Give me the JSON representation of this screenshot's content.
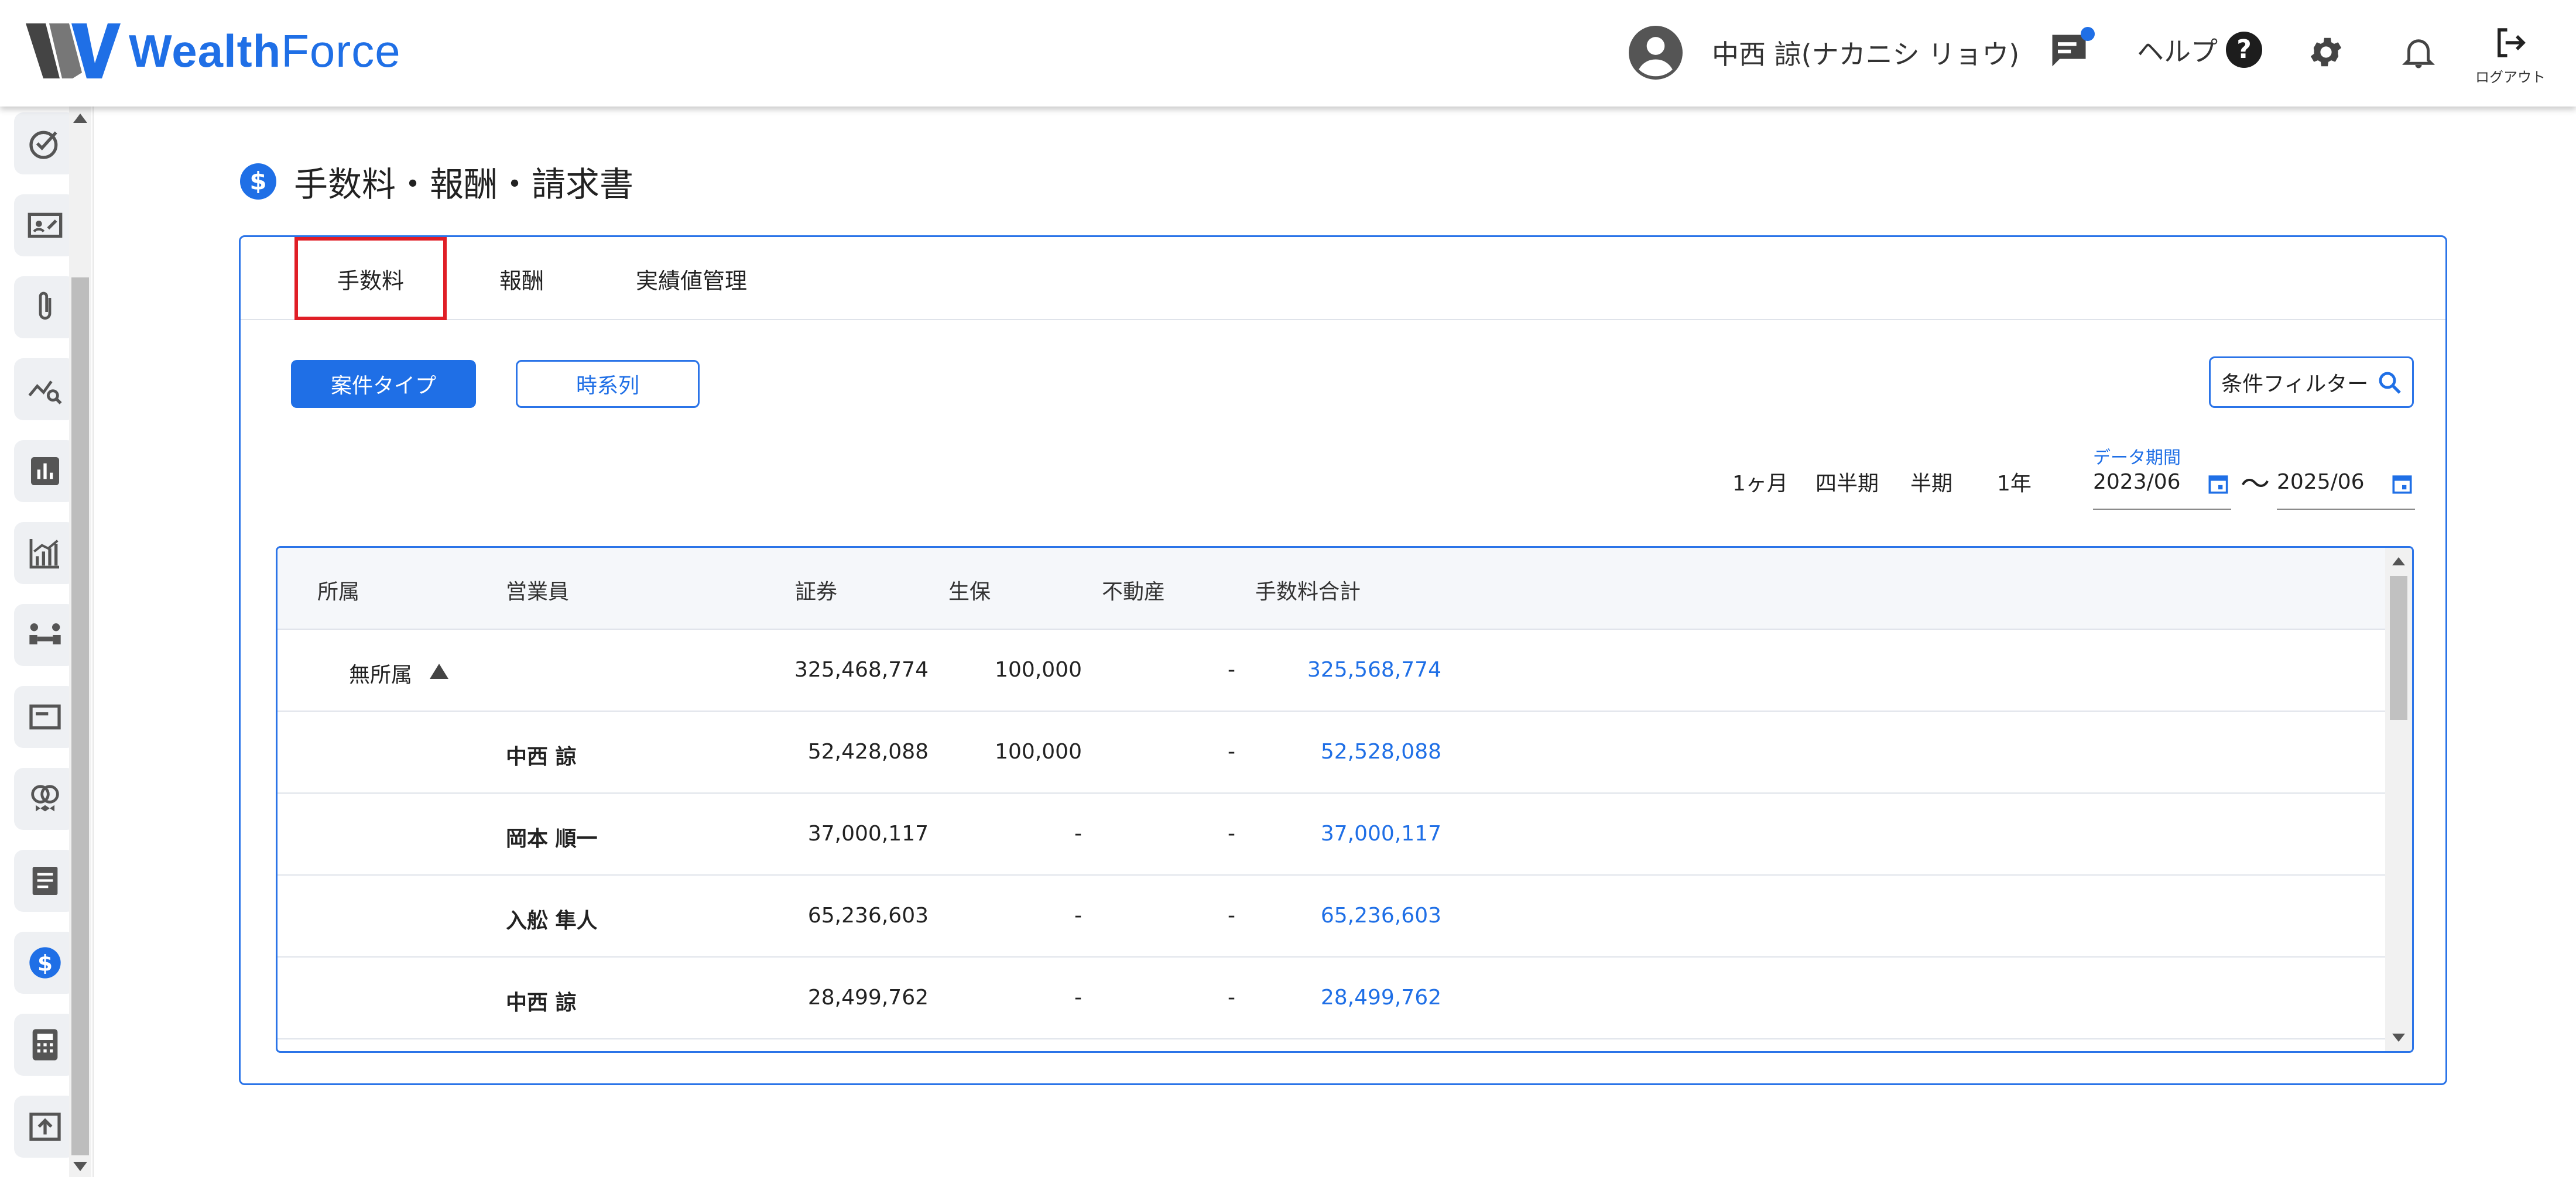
{
  "header": {
    "logo": {
      "part1": "Wealth",
      "part2": "Force"
    },
    "user_name": "中西 諒(ナカニシ リョウ)",
    "help_label": "ヘルプ",
    "logout_label": "ログアウト",
    "brand_color": "#1f6fe6"
  },
  "sidebar": {
    "icons": [
      "check-circle-icon",
      "id-card-icon",
      "paperclip-icon",
      "chart-search-icon",
      "bar-chart-icon",
      "analytics-icon",
      "meeting-icon",
      "card-icon",
      "rings-icon",
      "document-icon",
      "dollar-icon",
      "calculator-icon",
      "upload-icon"
    ]
  },
  "page": {
    "title": "手数料・報酬・請求書",
    "title_icon": "$"
  },
  "tabs": [
    "手数料",
    "報酬",
    "実績値管理"
  ],
  "toggle": {
    "primary": "案件タイプ",
    "secondary": "時系列"
  },
  "filter": {
    "label": "条件フィルター"
  },
  "periods": [
    "1ヶ月",
    "四半期",
    "半期",
    "1年"
  ],
  "date_range": {
    "label": "データ期間",
    "start": "2023/06",
    "end": "2025/06",
    "separator": "〜"
  },
  "table": {
    "columns": [
      "所属",
      "営業員",
      "証券",
      "生保",
      "不動産",
      "手数料合計"
    ],
    "rows": [
      {
        "dept": "無所属",
        "staff": "",
        "securities": "325,468,774",
        "life": "100,000",
        "realestate": "-",
        "total": "325,568,774"
      },
      {
        "dept": "",
        "staff": "中西 諒",
        "securities": "52,428,088",
        "life": "100,000",
        "realestate": "-",
        "total": "52,528,088"
      },
      {
        "dept": "",
        "staff": "岡本 順一",
        "securities": "37,000,117",
        "life": "-",
        "realestate": "-",
        "total": "37,000,117"
      },
      {
        "dept": "",
        "staff": "入舩 隼人",
        "securities": "65,236,603",
        "life": "-",
        "realestate": "-",
        "total": "65,236,603"
      },
      {
        "dept": "",
        "staff": "中西 諒",
        "securities": "28,499,762",
        "life": "-",
        "realestate": "-",
        "total": "28,499,762"
      }
    ]
  }
}
